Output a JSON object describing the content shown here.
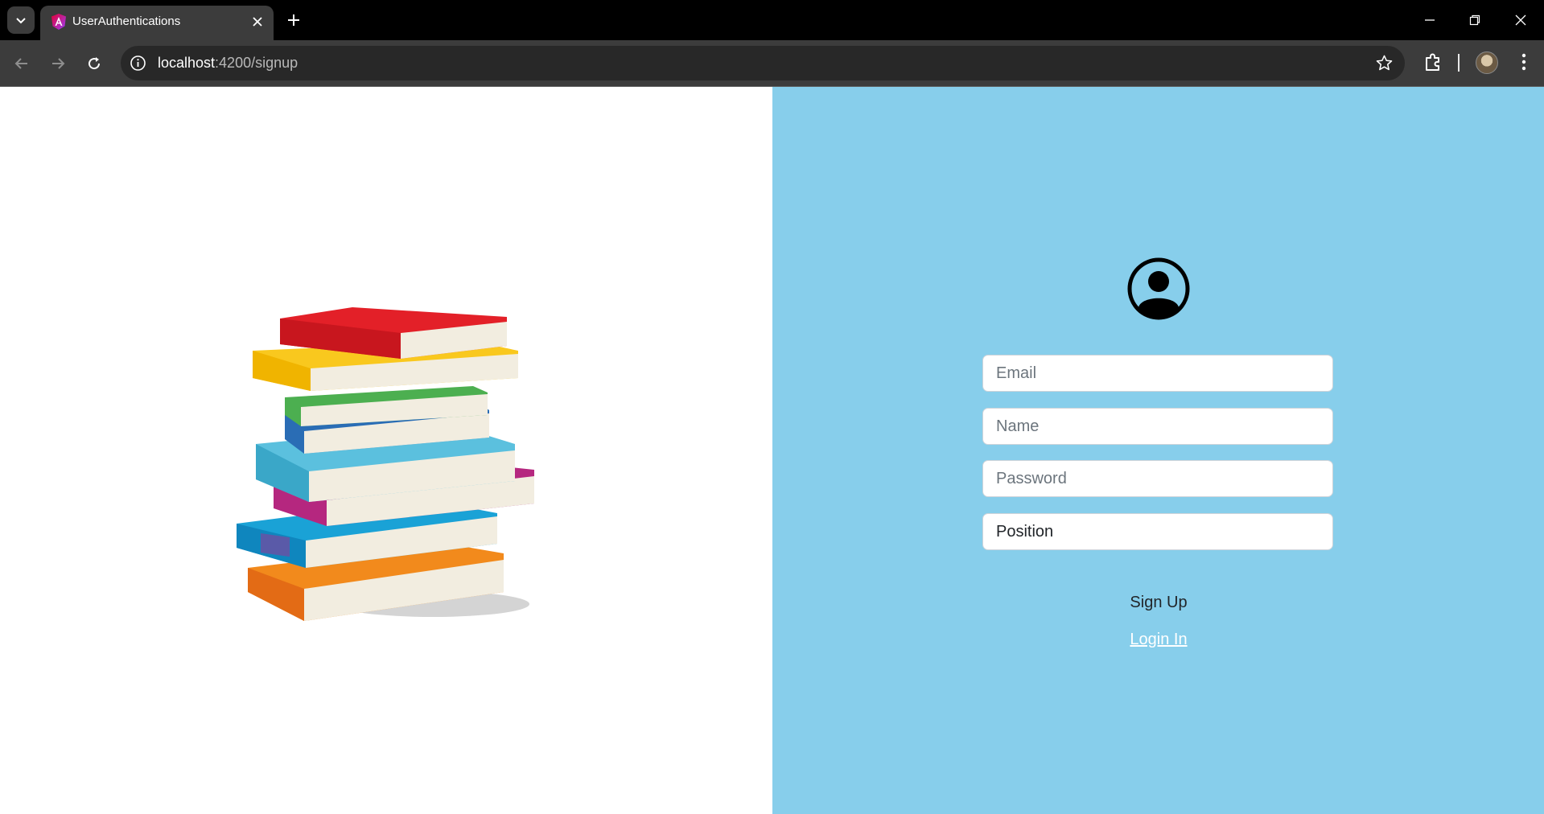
{
  "browser": {
    "tab_title": "UserAuthentications",
    "url_host": "localhost",
    "url_path": ":4200/signup"
  },
  "form": {
    "email_placeholder": "Email",
    "name_placeholder": "Name",
    "password_placeholder": "Password",
    "position_value": "Position",
    "signup_label": "Sign Up",
    "login_label": "Login In"
  },
  "colors": {
    "panel_bg": "#87ceeb",
    "chrome_dark": "#000000",
    "toolbar": "#3c3c3c"
  },
  "icons": [
    "tab-search-icon",
    "angular-favicon-icon",
    "close-icon",
    "plus-icon",
    "minimize-icon",
    "restore-icon",
    "window-close-icon",
    "back-arrow-icon",
    "forward-arrow-icon",
    "reload-icon",
    "info-icon",
    "star-icon",
    "extensions-icon",
    "profile-avatar",
    "more-menu-icon",
    "user-circle-icon"
  ]
}
